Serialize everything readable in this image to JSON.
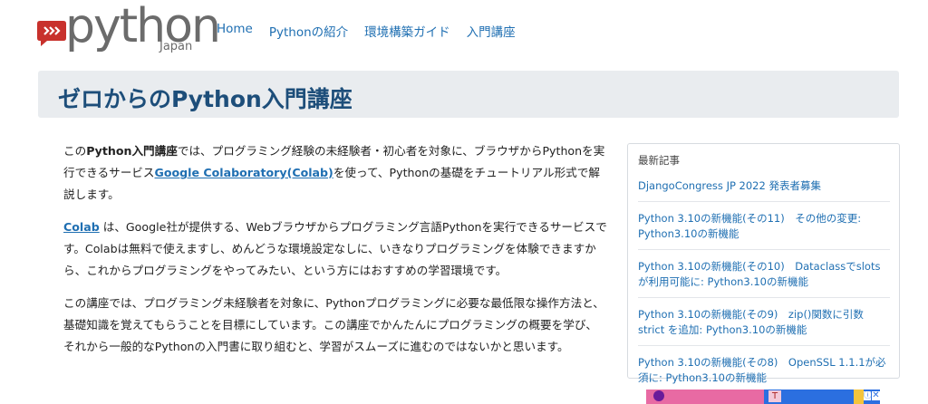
{
  "header": {
    "logo_text": "python",
    "logo_sub": "Japan",
    "nav": [
      "Home",
      "Pythonの紹介",
      "環境構築ガイド",
      "入門講座"
    ]
  },
  "page_title": "ゼロからのPython入門講座",
  "intro": {
    "p1_a": "この",
    "p1_b": "Python入門講座",
    "p1_c": "では、プログラミング経験の未経験者・初心者を対象に、ブラウザからPythonを実行できるサービス",
    "p1_link": "Google Colaboratory(Colab)",
    "p1_d": "を使って、Pythonの基礎をチュートリアル形式で解説します。",
    "p2_link": "Colab",
    "p2_rest": " は、Google社が提供する、Webブラウザからプログラミング言語Pythonを実行できるサービスです。Colabは無料で使えますし、めんどうな環境設定なしに、いきなりプログラミングを体験できますから、これからプログラミングをやってみたい、という方にはおすすめの学習環境です。",
    "p3": "この講座では、プログラミング未経験者を対象に、Pythonプログラミングに必要な最低限な操作方法と、基礎知識を覚えてもらうことを目標にしています。この講座でかんたんにプログラミングの概要を学び、それから一般的なPythonの入門書に取り組むと、学習がスムーズに進むのではないかと思います。"
  },
  "sidebar": {
    "title": "最新記事",
    "items": [
      "DjangoCongress JP 2022 発表者募集",
      "Python 3.10の新機能(その11)　その他の変更: Python3.10の新機能",
      "Python 3.10の新機能(その10)　Dataclassでslotsが利用可能に: Python3.10の新機能",
      "Python 3.10の新機能(その9)　zip()関数に引数 strict を追加: Python3.10の新機能",
      "Python 3.10の新機能(その8)　OpenSSL 1.1.1が必須に: Python3.10の新機能"
    ]
  },
  "ad": {
    "t_label": "T",
    "info_label": "ⓘ",
    "close_label": "✕"
  },
  "colors": {
    "link": "#1f6fb2",
    "title": "#1d4e7a",
    "logo_red": "#c8312c"
  }
}
